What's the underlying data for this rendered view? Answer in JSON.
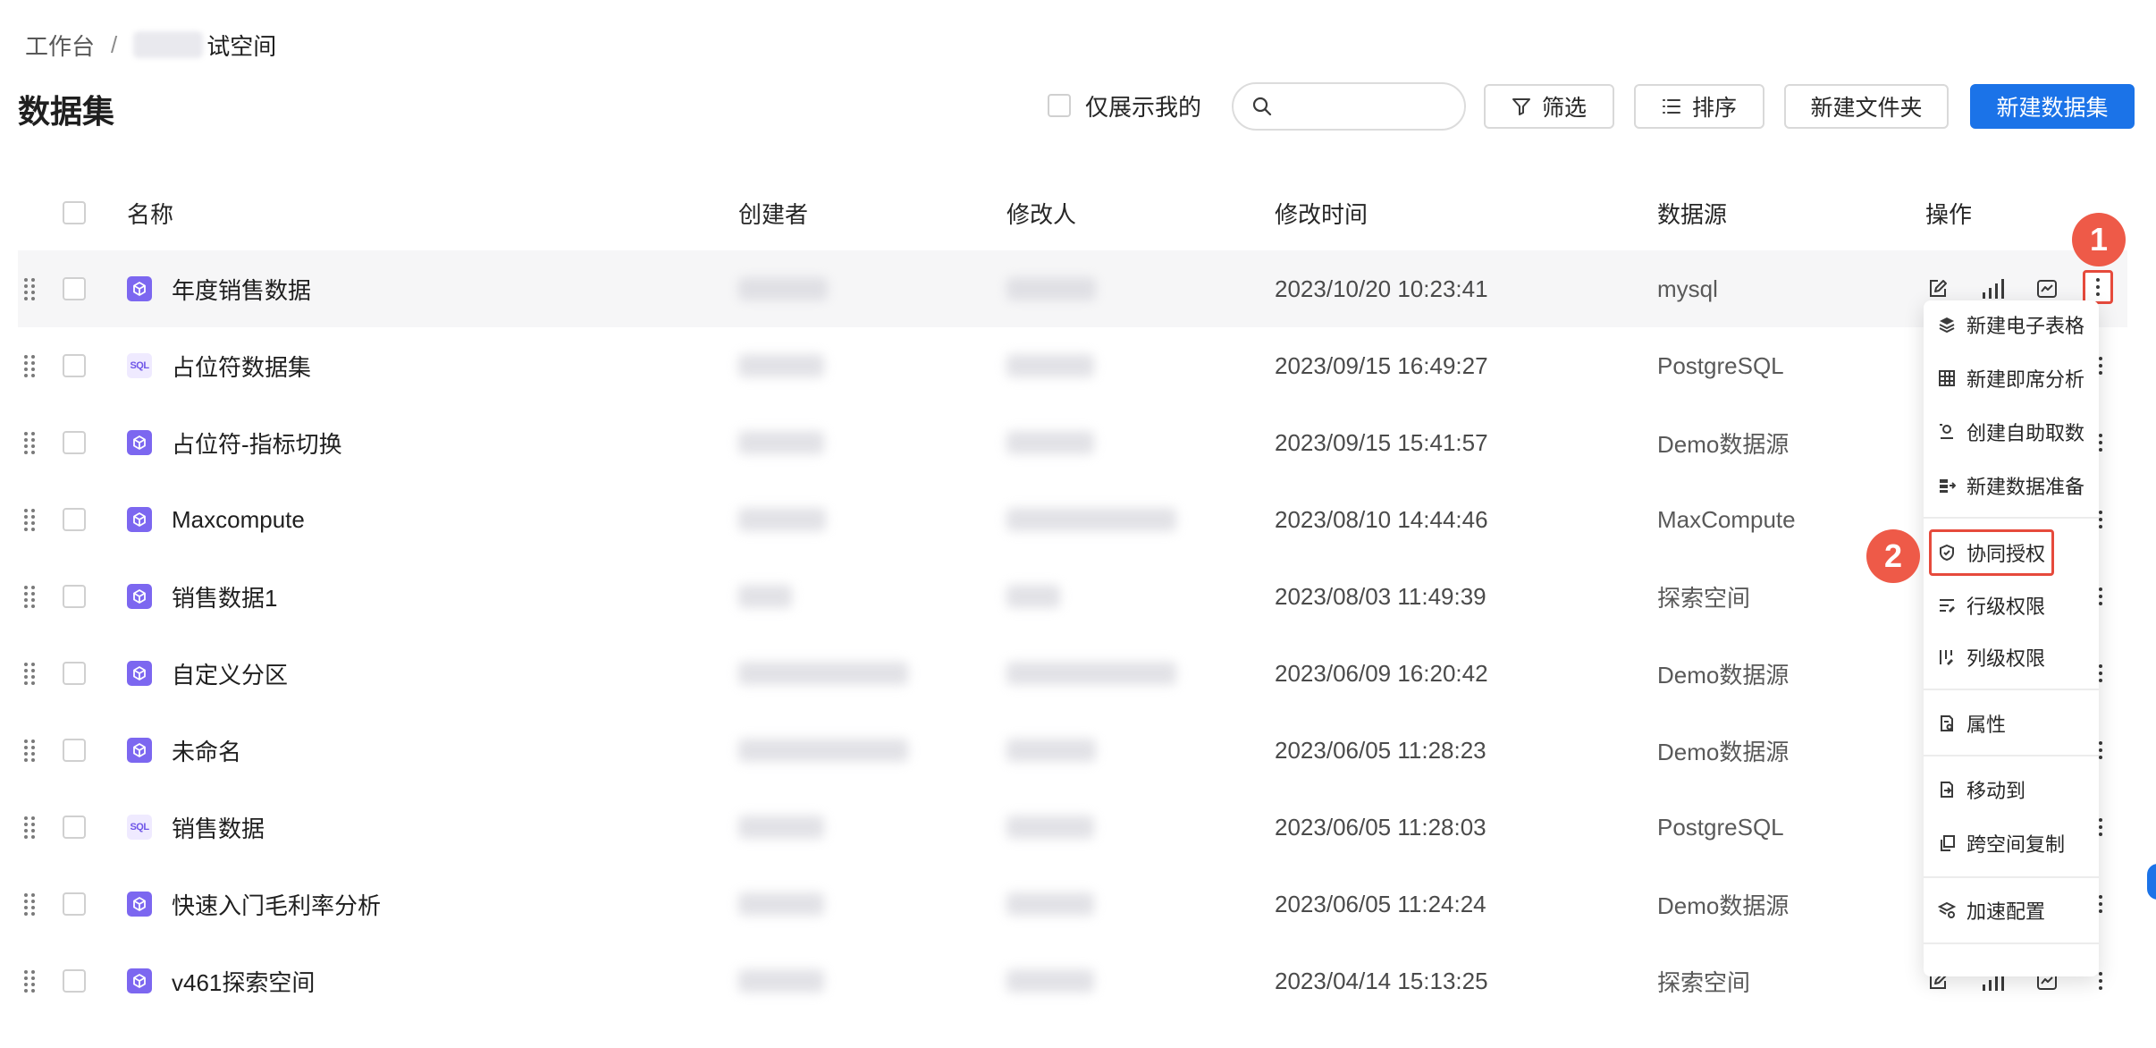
{
  "breadcrumb": {
    "home": "工作台",
    "separator": "/",
    "space_suffix": "试空间"
  },
  "page": {
    "title": "数据集"
  },
  "toolbar": {
    "only_mine": "仅展示我的",
    "search_placeholder": "",
    "filter": "筛选",
    "sort": "排序",
    "new_folder": "新建文件夹",
    "new_dataset": "新建数据集"
  },
  "table": {
    "headers": {
      "name": "名称",
      "creator": "创建者",
      "modifier": "修改人",
      "time": "修改时间",
      "source": "数据源",
      "ops": "操作"
    },
    "rows": [
      {
        "name": "年度销售数据",
        "icon": "cube-icon",
        "time": "2023/10/20 10:23:41",
        "source": "mysql"
      },
      {
        "name": "占位符数据集",
        "icon": "sql-icon",
        "time": "2023/09/15 16:49:27",
        "source": "PostgreSQL"
      },
      {
        "name": "占位符-指标切换",
        "icon": "cube-icon",
        "time": "2023/09/15 15:41:57",
        "source": "Demo数据源"
      },
      {
        "name": "Maxcompute",
        "icon": "cube-icon",
        "time": "2023/08/10 14:44:46",
        "source": "MaxCompute"
      },
      {
        "name": "销售数据1",
        "icon": "cube-icon",
        "time": "2023/08/03 11:49:39",
        "source": "探索空间"
      },
      {
        "name": "自定义分区",
        "icon": "cube-icon",
        "time": "2023/06/09 16:20:42",
        "source": "Demo数据源"
      },
      {
        "name": "未命名",
        "icon": "cube-icon",
        "time": "2023/06/05 11:28:23",
        "source": "Demo数据源"
      },
      {
        "name": "销售数据",
        "icon": "sql-icon",
        "time": "2023/06/05 11:28:03",
        "source": "PostgreSQL"
      },
      {
        "name": "快速入门毛利率分析",
        "icon": "cube-icon",
        "time": "2023/06/05 11:24:24",
        "source": "Demo数据源"
      },
      {
        "name": "v461探索空间",
        "icon": "cube-icon",
        "time": "2023/04/14 15:13:25",
        "source": "探索空间"
      }
    ]
  },
  "icon_labels": {
    "sql": "SQL"
  },
  "menu": {
    "new_spreadsheet": "新建电子表格",
    "new_adhoc": "新建即席分析",
    "self_service": "创建自助取数",
    "data_prep": "新建数据准备",
    "collab_auth": "协同授权",
    "row_perm": "行级权限",
    "col_perm": "列级权限",
    "properties": "属性",
    "move_to": "移动到",
    "cross_copy": "跨空间复制",
    "accel_config": "加速配置"
  },
  "callouts": {
    "one": "1",
    "two": "2"
  },
  "colors": {
    "primary": "#1b73e8",
    "callout": "#ee5a48",
    "dataset_icon": "#7c67f0"
  }
}
